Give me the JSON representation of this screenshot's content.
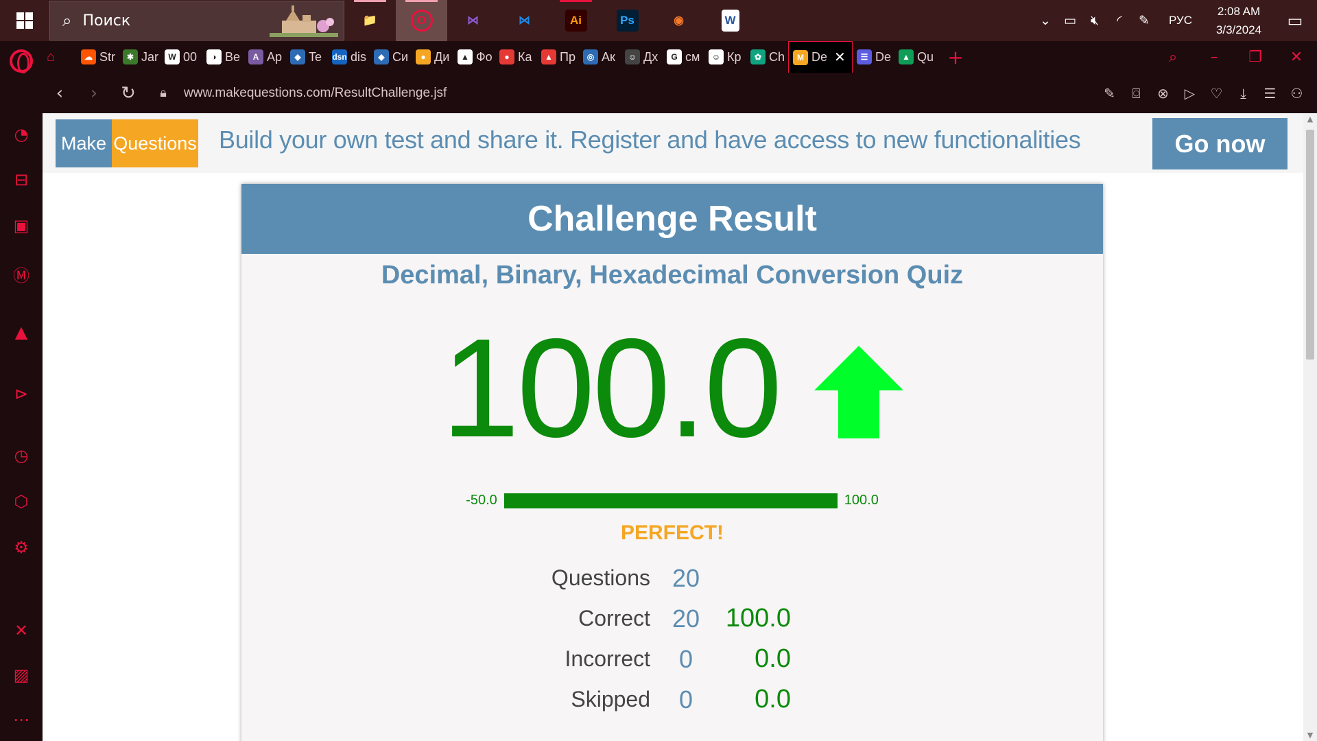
{
  "taskbar": {
    "search_label": "Поиск",
    "apps": [
      {
        "name": "file-explorer",
        "glyph": "📁",
        "color": "#f4c542"
      },
      {
        "name": "opera",
        "glyph": "O",
        "color": "#e8123c"
      },
      {
        "name": "visual-studio",
        "glyph": "⋈",
        "color": "#8c5bd6"
      },
      {
        "name": "vscode",
        "glyph": "⋈",
        "color": "#1e88e5"
      },
      {
        "name": "illustrator",
        "glyph": "Ai",
        "color": "#ff9a00"
      },
      {
        "name": "photoshop",
        "glyph": "Ps",
        "color": "#31a8ff"
      },
      {
        "name": "blender",
        "glyph": "◉",
        "color": "#f5792a"
      },
      {
        "name": "word",
        "glyph": "W",
        "color": "#2b579a"
      }
    ],
    "tray": {
      "language": "РУС",
      "time": "2:08 AM",
      "date": "3/3/2024"
    }
  },
  "tabs": [
    {
      "label": "Str",
      "fav_color": "#ff5500",
      "fav_glyph": "☁"
    },
    {
      "label": "Jar",
      "fav_color": "#3a7a2a",
      "fav_glyph": "✱"
    },
    {
      "label": "00",
      "fav_color": "#ffffff",
      "fav_glyph": "W"
    },
    {
      "label": "Be",
      "fav_color": "#ffffff",
      "fav_glyph": "◑"
    },
    {
      "label": "Ap",
      "fav_color": "#7a5aa0",
      "fav_glyph": "A"
    },
    {
      "label": "Te",
      "fav_color": "#2d6cb5",
      "fav_glyph": "◆"
    },
    {
      "label": "dis",
      "fav_color": "#1565c0",
      "fav_glyph": "dsn"
    },
    {
      "label": "Си",
      "fav_color": "#2d6cb5",
      "fav_glyph": "◆"
    },
    {
      "label": "Ди",
      "fav_color": "#f5a623",
      "fav_glyph": "●"
    },
    {
      "label": "Фо",
      "fav_color": "#ffffff",
      "fav_glyph": "▲"
    },
    {
      "label": "Ка",
      "fav_color": "#e53935",
      "fav_glyph": "●"
    },
    {
      "label": "Пр",
      "fav_color": "#e53935",
      "fav_glyph": "▲"
    },
    {
      "label": "Ак",
      "fav_color": "#2d6cb5",
      "fav_glyph": "◎"
    },
    {
      "label": "Дх",
      "fav_color": "#444444",
      "fav_glyph": "☺"
    },
    {
      "label": "см",
      "fav_color": "#ffffff",
      "fav_glyph": "G"
    },
    {
      "label": "Кр",
      "fav_color": "#ffffff",
      "fav_glyph": "☺"
    },
    {
      "label": "Ch",
      "fav_color": "#10a37f",
      "fav_glyph": "✿"
    },
    {
      "label": "De",
      "fav_color": "#f5a623",
      "fav_glyph": "M",
      "active": true
    },
    {
      "label": "De",
      "fav_color": "#5c5ce0",
      "fav_glyph": "☰"
    },
    {
      "label": "Qu",
      "fav_color": "#0f9d58",
      "fav_glyph": "▲"
    }
  ],
  "address": {
    "url": "www.makequestions.com/ResultChallenge.jsf"
  },
  "banner": {
    "logo_left": "Make",
    "logo_right": "Questions",
    "promo": "Build your own test and share it. Register and have access to new functionalities",
    "go_now": "Go now"
  },
  "result": {
    "header": "Challenge Result",
    "quiz_title": "Decimal, Binary, Hexadecimal Conversion Quiz",
    "score": "100.0",
    "bar_min": "-50.0",
    "bar_max": "100.0",
    "bar_fill_fraction": 1.0,
    "verdict": "PERFECT!",
    "arrow_color": "#00ff2a",
    "score_color": "#0b8a0b",
    "stats": [
      {
        "label": "Questions",
        "count": "20",
        "percent": ""
      },
      {
        "label": "Correct",
        "count": "20",
        "percent": "100.0"
      },
      {
        "label": "Incorrect",
        "count": "0",
        "percent": "0.0"
      },
      {
        "label": "Skipped",
        "count": "0",
        "percent": "0.0"
      }
    ]
  }
}
